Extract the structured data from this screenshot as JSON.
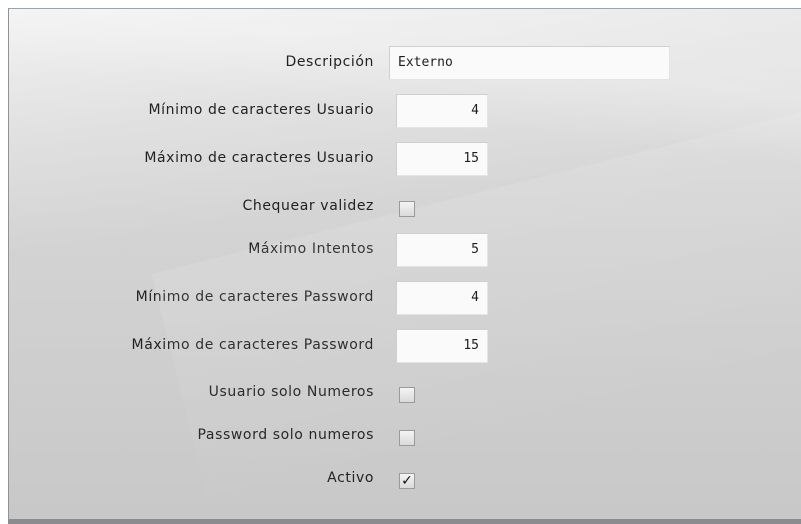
{
  "form": {
    "descripcion": {
      "label": "Descripción",
      "value": "Externo"
    },
    "min_usuario": {
      "label": "Mínimo de caracteres Usuario",
      "value": "4"
    },
    "max_usuario": {
      "label": "Máximo de caracteres Usuario",
      "value": "15"
    },
    "chequear_validez": {
      "label": "Chequear validez",
      "checked": false,
      "mark": ""
    },
    "max_intentos": {
      "label": "Máximo Intentos",
      "value": "5"
    },
    "min_password": {
      "label": "Mínimo de caracteres Password",
      "value": "4"
    },
    "max_password": {
      "label": "Máximo de caracteres Password",
      "value": "15"
    },
    "usuario_solo_numeros": {
      "label": "Usuario solo Numeros",
      "checked": false,
      "mark": ""
    },
    "password_solo_numeros": {
      "label": "Password solo numeros",
      "checked": false,
      "mark": ""
    },
    "activo": {
      "label": "Activo",
      "checked": true,
      "mark": "✓"
    }
  },
  "icons": {
    "checkmark": "check-icon"
  }
}
